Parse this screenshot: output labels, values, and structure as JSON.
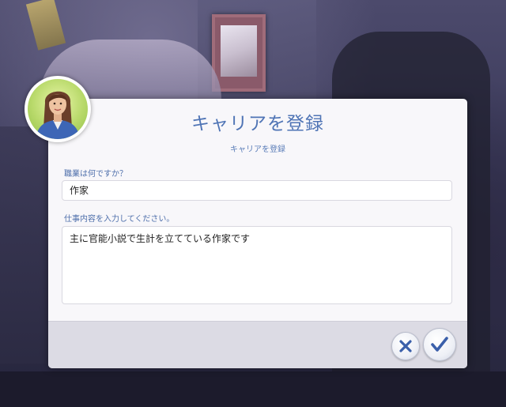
{
  "dialog": {
    "title": "キャリアを登録",
    "subtitle": "キャリアを登録",
    "job_label": "職業は何ですか？",
    "job_value": "作家",
    "description_label": "仕事内容を入力してください。",
    "description_value": "主に官能小説で生計を立てている作家です"
  },
  "buttons": {
    "cancel_icon": "close-x-icon",
    "confirm_icon": "checkmark-icon"
  },
  "colors": {
    "title_blue": "#4f74b5",
    "button_icon_blue": "#3a5faa",
    "panel_bg": "#f8f7fa",
    "footer_bg": "#dcdbe4"
  }
}
